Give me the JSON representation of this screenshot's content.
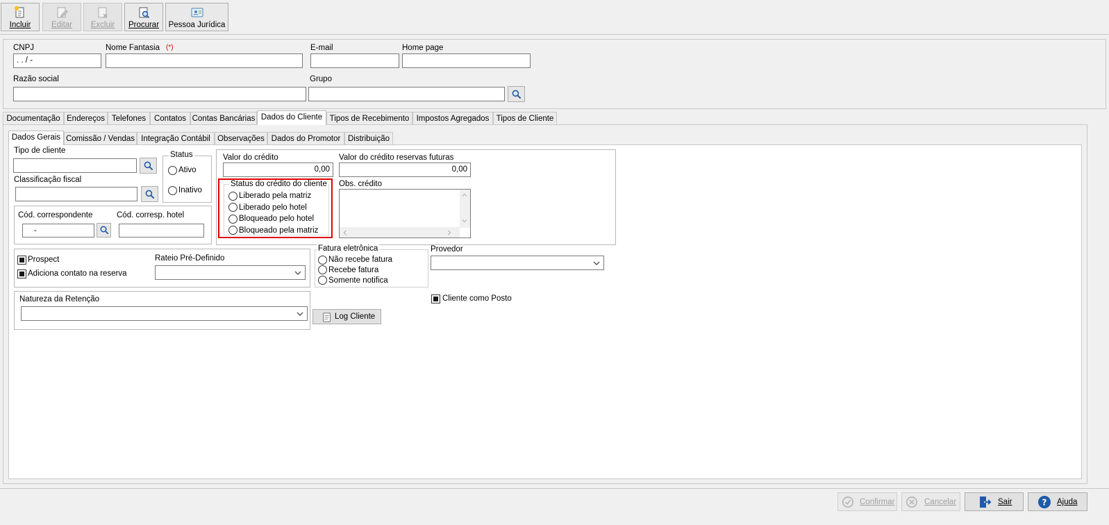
{
  "toolbar": {
    "incluir": "Incluir",
    "editar": "Editar",
    "excluir": "Excluir",
    "procurar": "Procurar",
    "pessoa_juridica": "Pessoa Jurídica"
  },
  "header": {
    "cnpj_label": "CNPJ",
    "cnpj_mask": " .  .  /   -",
    "nome_fantasia_label": "Nome Fantasia",
    "required_mark": "(*)",
    "email_label": "E-mail",
    "homepage_label": "Home page",
    "razao_social_label": "Razão social",
    "grupo_label": "Grupo"
  },
  "main_tabs": [
    "Documentação",
    "Endereços",
    "Telefones",
    "Contatos",
    "Contas Bancárias",
    "Dados do Cliente",
    "Tipos de Recebimento",
    "Impostos Agregados",
    "Tipos de Cliente"
  ],
  "sub_tabs": [
    "Dados Gerais",
    "Comissão / Vendas",
    "Integração Contábil",
    "Observações",
    "Dados do Promotor",
    "Distribuição"
  ],
  "dados_gerais": {
    "tipo_cliente_label": "Tipo de cliente",
    "classificacao_fiscal_label": "Classificação fiscal",
    "status_title": "Status",
    "status_ativo": "Ativo",
    "status_inativo": "Inativo",
    "cod_correspondente_label": "Cód. correspondente",
    "cod_correspondente_value": "-",
    "cod_corresp_hotel_label": "Cód. corresp. hotel",
    "valor_credito_label": "Valor do crédito",
    "valor_credito_value": "0,00",
    "valor_credito_futuras_label": "Valor do crédito reservas futuras",
    "valor_credito_futuras_value": "0,00",
    "status_credito_title": "Status do crédito do cliente",
    "status_credito_options": [
      "Liberado pela matriz",
      "Liberado pelo hotel",
      "Bloqueado pelo hotel",
      "Bloqueado pela matriz"
    ],
    "obs_credito_label": "Obs. crédito",
    "prospect_label": "Prospect",
    "adiciona_contato_label": "Adiciona contato na reserva",
    "rateio_label": "Rateio Pré-Definido",
    "fatura_title": "Fatura eletrônica",
    "fatura_options": [
      "Não recebe fatura",
      "Recebe fatura",
      "Somente notifica"
    ],
    "provedor_label": "Provedor",
    "natureza_retencao_label": "Natureza da Retenção",
    "log_cliente_label": "Log Cliente",
    "cliente_posto_label": "Cliente como Posto"
  },
  "footer": {
    "confirmar": "Confirmar",
    "cancelar": "Cancelar",
    "sair": "Sair",
    "ajuda": "Ajuda"
  },
  "colors": {
    "highlight": "#e00000",
    "accent": "#1e5aa8"
  }
}
